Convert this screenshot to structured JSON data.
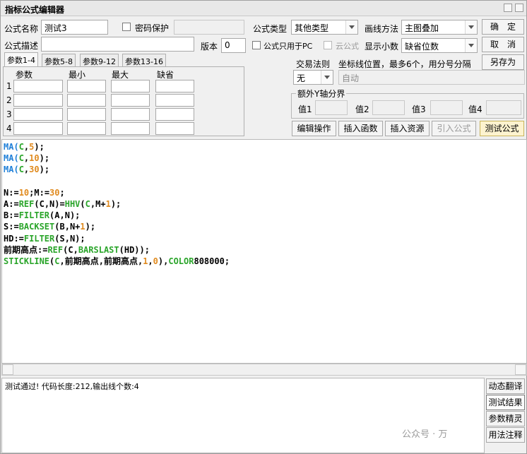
{
  "window": {
    "title": "指标公式编辑器"
  },
  "form": {
    "name_label": "公式名称",
    "name_value": "测试3",
    "password_label": "密码保护",
    "password_value": "",
    "desc_label": "公式描述",
    "desc_value": "",
    "version_label": "版本",
    "version_value": "0",
    "type_label": "公式类型",
    "type_value": "其他类型",
    "draw_label": "画线方法",
    "draw_value": "主图叠加",
    "pc_only_label": "公式只用于PC",
    "cloud_label": "云公式",
    "decimals_label": "显示小数",
    "decimals_value": "缺省位数"
  },
  "buttons": {
    "ok": "确　定",
    "cancel": "取　消",
    "save_as": "另存为",
    "edit_ops": "编辑操作",
    "insert_func": "插入函数",
    "insert_res": "插入资源",
    "import_formula": "引入公式",
    "test_formula": "测试公式"
  },
  "params": {
    "tabs": [
      "参数1-4",
      "参数5-8",
      "参数9-12",
      "参数13-16"
    ],
    "headers": [
      "参数",
      "最小",
      "最大",
      "缺省"
    ],
    "rows": [
      "1",
      "2",
      "3",
      "4"
    ]
  },
  "trade": {
    "rule_label": "交易法则",
    "rule_value": "无",
    "axis_label": "坐标线位置，最多6个，用分号分隔",
    "axis_value": "自动"
  },
  "extra_axis": {
    "title": "额外Y轴分界",
    "labels": [
      "值1",
      "值2",
      "值3",
      "值4"
    ]
  },
  "code_lines": [
    [
      [
        "MA(",
        "#1e7fd8"
      ],
      [
        "C",
        "#2aa52a"
      ],
      [
        ",",
        "#000000"
      ],
      [
        "5",
        "#e08a1e"
      ],
      [
        ");",
        "#000000"
      ]
    ],
    [
      [
        "MA(",
        "#1e7fd8"
      ],
      [
        "C",
        "#2aa52a"
      ],
      [
        ",",
        "#000000"
      ],
      [
        "10",
        "#e08a1e"
      ],
      [
        ");",
        "#000000"
      ]
    ],
    [
      [
        "MA(",
        "#1e7fd8"
      ],
      [
        "C",
        "#2aa52a"
      ],
      [
        ",",
        "#000000"
      ],
      [
        "30",
        "#e08a1e"
      ],
      [
        ");",
        "#000000"
      ]
    ],
    [],
    [
      [
        "N:=",
        "#000000"
      ],
      [
        "10",
        "#e08a1e"
      ],
      [
        ";M:=",
        "#000000"
      ],
      [
        "30",
        "#e08a1e"
      ],
      [
        ";",
        "#000000"
      ]
    ],
    [
      [
        "A:=",
        "#000000"
      ],
      [
        "REF",
        "#2aa52a"
      ],
      [
        "(C,N)=",
        "#000000"
      ],
      [
        "HHV",
        "#2aa52a"
      ],
      [
        "(",
        "#000000"
      ],
      [
        "C",
        "#2aa52a"
      ],
      [
        ",M+",
        "#000000"
      ],
      [
        "1",
        "#e08a1e"
      ],
      [
        ");",
        "#000000"
      ]
    ],
    [
      [
        "B:=",
        "#000000"
      ],
      [
        "FILTER",
        "#2aa52a"
      ],
      [
        "(A,N);",
        "#000000"
      ]
    ],
    [
      [
        "S:=",
        "#000000"
      ],
      [
        "BACKSET",
        "#2aa52a"
      ],
      [
        "(B,N+",
        "#000000"
      ],
      [
        "1",
        "#e08a1e"
      ],
      [
        ");",
        "#000000"
      ]
    ],
    [
      [
        "HD:=",
        "#000000"
      ],
      [
        "FILTER",
        "#2aa52a"
      ],
      [
        "(S,N);",
        "#000000"
      ]
    ],
    [
      [
        "前期高点:=",
        "#000000"
      ],
      [
        "REF",
        "#2aa52a"
      ],
      [
        "(C,",
        "#000000"
      ],
      [
        "BARSLAST",
        "#2aa52a"
      ],
      [
        "(HD));",
        "#000000"
      ]
    ],
    [
      [
        "STICKLINE",
        "#2aa52a"
      ],
      [
        "(",
        "#000000"
      ],
      [
        "C",
        "#2aa52a"
      ],
      [
        ",前期高点,前期高点,",
        "#000000"
      ],
      [
        "1",
        "#e08a1e"
      ],
      [
        ",",
        "#000000"
      ],
      [
        "0",
        "#e08a1e"
      ],
      [
        "),",
        "#000000"
      ],
      [
        "COLOR",
        "#2aa52a"
      ],
      [
        "808000;",
        "#000000"
      ]
    ]
  ],
  "output": {
    "text": "测试通过! 代码长度:212,输出线个数:4"
  },
  "side_buttons": [
    "动态翻译",
    "测试结果",
    "参数精灵",
    "用法注释"
  ],
  "watermark": "公众号 · 万"
}
